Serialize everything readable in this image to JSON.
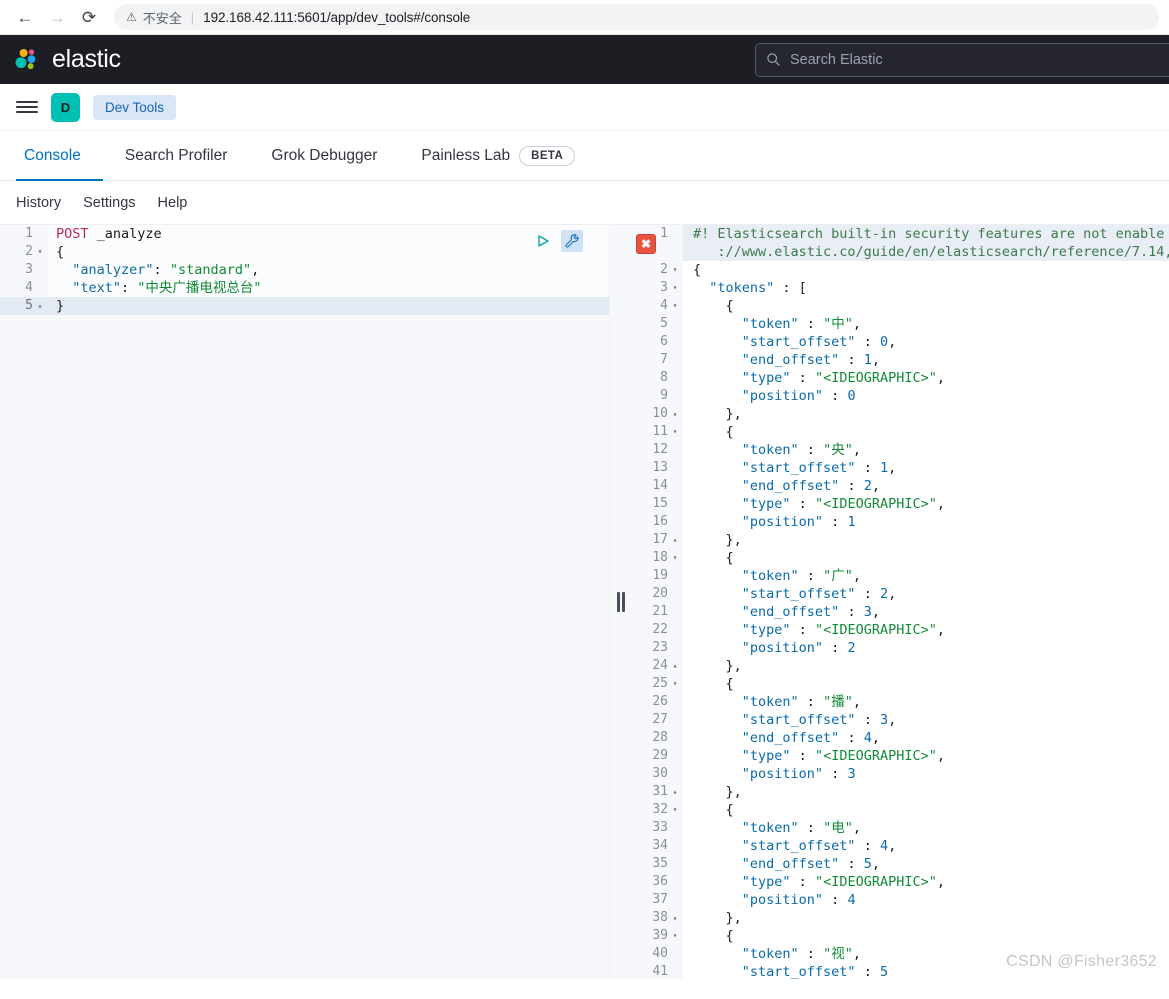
{
  "browser": {
    "back_icon": "arrow-left-icon",
    "forward_icon": "arrow-right-icon",
    "reload_icon": "reload-icon",
    "insecure_label": "不安全",
    "divider": "|",
    "url": "192.168.42.111:5601/app/dev_tools#/console"
  },
  "header": {
    "brand": "elastic",
    "search_placeholder": "Search Elastic"
  },
  "breadcrumb": {
    "menu_icon": "hamburger-menu-icon",
    "avatar_letter": "D",
    "space_badge": "Dev Tools"
  },
  "tabs": [
    {
      "label": "Console",
      "active": true
    },
    {
      "label": "Search Profiler",
      "active": false
    },
    {
      "label": "Grok Debugger",
      "active": false
    },
    {
      "label": "Painless Lab",
      "active": false,
      "badge": "BETA"
    }
  ],
  "subnav": [
    "History",
    "Settings",
    "Help"
  ],
  "editor_actions": {
    "play_icon": "play-triangle-icon",
    "wrench_icon": "wrench-icon"
  },
  "splitter": {
    "grip_icon": "drag-handle-icon"
  },
  "request": {
    "lines": [
      {
        "n": 1,
        "fold": "",
        "active": false,
        "tokens": [
          {
            "t": "POST ",
            "c": "t-method"
          },
          {
            "t": "_analyze",
            "c": "t-url"
          }
        ]
      },
      {
        "n": 2,
        "fold": "down",
        "active": false,
        "tokens": [
          {
            "t": "{",
            "c": "t-brace"
          }
        ]
      },
      {
        "n": 3,
        "fold": "",
        "active": false,
        "indent": 1,
        "tokens": [
          {
            "t": "  \"analyzer\"",
            "c": "t-key"
          },
          {
            "t": ": ",
            "c": "t-punct"
          },
          {
            "t": "\"standard\"",
            "c": "t-str"
          },
          {
            "t": ",",
            "c": "t-punct"
          }
        ]
      },
      {
        "n": 4,
        "fold": "",
        "active": false,
        "indent": 1,
        "tokens": [
          {
            "t": "  \"text\"",
            "c": "t-key"
          },
          {
            "t": ": ",
            "c": "t-punct"
          },
          {
            "t": "\"中央广播电视总台\"",
            "c": "t-str"
          }
        ]
      },
      {
        "n": 5,
        "fold": "up",
        "active": true,
        "tokens": [
          {
            "t": "}",
            "c": "t-brace"
          }
        ]
      }
    ]
  },
  "response": {
    "error_marker": "error-x-icon",
    "lines": [
      {
        "n": 1,
        "fold": "",
        "warn": true,
        "tokens": [
          {
            "t": "#! Elasticsearch built-in security features are not enable",
            "c": "t-cmt"
          }
        ]
      },
      {
        "n": "",
        "fold": "",
        "warn": true,
        "tokens": [
          {
            "t": "   ://www.elastic.co/guide/en/elasticsearch/reference/7.14,",
            "c": "t-cmt"
          }
        ]
      },
      {
        "n": 2,
        "fold": "down",
        "tokens": [
          {
            "t": "{",
            "c": "t-brace"
          }
        ]
      },
      {
        "n": 3,
        "fold": "down",
        "indent": 1,
        "tokens": [
          {
            "t": "  \"tokens\"",
            "c": "t-key"
          },
          {
            "t": " : ",
            "c": "t-punct"
          },
          {
            "t": "[",
            "c": "t-brace"
          }
        ]
      },
      {
        "n": 4,
        "fold": "down",
        "indent": 2,
        "tokens": [
          {
            "t": "    {",
            "c": "t-brace"
          }
        ]
      },
      {
        "n": 5,
        "fold": "",
        "indent": 3,
        "tokens": [
          {
            "t": "      \"token\"",
            "c": "t-key"
          },
          {
            "t": " : ",
            "c": "t-punct"
          },
          {
            "t": "\"中\"",
            "c": "t-str"
          },
          {
            "t": ",",
            "c": "t-punct"
          }
        ]
      },
      {
        "n": 6,
        "fold": "",
        "indent": 3,
        "tokens": [
          {
            "t": "      \"start_offset\"",
            "c": "t-key"
          },
          {
            "t": " : ",
            "c": "t-punct"
          },
          {
            "t": "0",
            "c": "t-num"
          },
          {
            "t": ",",
            "c": "t-punct"
          }
        ]
      },
      {
        "n": 7,
        "fold": "",
        "indent": 3,
        "tokens": [
          {
            "t": "      \"end_offset\"",
            "c": "t-key"
          },
          {
            "t": " : ",
            "c": "t-punct"
          },
          {
            "t": "1",
            "c": "t-num"
          },
          {
            "t": ",",
            "c": "t-punct"
          }
        ]
      },
      {
        "n": 8,
        "fold": "",
        "indent": 3,
        "tokens": [
          {
            "t": "      \"type\"",
            "c": "t-key"
          },
          {
            "t": " : ",
            "c": "t-punct"
          },
          {
            "t": "\"<IDEOGRAPHIC>\"",
            "c": "t-str"
          },
          {
            "t": ",",
            "c": "t-punct"
          }
        ]
      },
      {
        "n": 9,
        "fold": "",
        "indent": 3,
        "tokens": [
          {
            "t": "      \"position\"",
            "c": "t-key"
          },
          {
            "t": " : ",
            "c": "t-punct"
          },
          {
            "t": "0",
            "c": "t-num"
          }
        ]
      },
      {
        "n": 10,
        "fold": "up",
        "indent": 2,
        "tokens": [
          {
            "t": "    },",
            "c": "t-brace"
          }
        ]
      },
      {
        "n": 11,
        "fold": "down",
        "indent": 2,
        "tokens": [
          {
            "t": "    {",
            "c": "t-brace"
          }
        ]
      },
      {
        "n": 12,
        "fold": "",
        "indent": 3,
        "tokens": [
          {
            "t": "      \"token\"",
            "c": "t-key"
          },
          {
            "t": " : ",
            "c": "t-punct"
          },
          {
            "t": "\"央\"",
            "c": "t-str"
          },
          {
            "t": ",",
            "c": "t-punct"
          }
        ]
      },
      {
        "n": 13,
        "fold": "",
        "indent": 3,
        "tokens": [
          {
            "t": "      \"start_offset\"",
            "c": "t-key"
          },
          {
            "t": " : ",
            "c": "t-punct"
          },
          {
            "t": "1",
            "c": "t-num"
          },
          {
            "t": ",",
            "c": "t-punct"
          }
        ]
      },
      {
        "n": 14,
        "fold": "",
        "indent": 3,
        "tokens": [
          {
            "t": "      \"end_offset\"",
            "c": "t-key"
          },
          {
            "t": " : ",
            "c": "t-punct"
          },
          {
            "t": "2",
            "c": "t-num"
          },
          {
            "t": ",",
            "c": "t-punct"
          }
        ]
      },
      {
        "n": 15,
        "fold": "",
        "indent": 3,
        "tokens": [
          {
            "t": "      \"type\"",
            "c": "t-key"
          },
          {
            "t": " : ",
            "c": "t-punct"
          },
          {
            "t": "\"<IDEOGRAPHIC>\"",
            "c": "t-str"
          },
          {
            "t": ",",
            "c": "t-punct"
          }
        ]
      },
      {
        "n": 16,
        "fold": "",
        "indent": 3,
        "tokens": [
          {
            "t": "      \"position\"",
            "c": "t-key"
          },
          {
            "t": " : ",
            "c": "t-punct"
          },
          {
            "t": "1",
            "c": "t-num"
          }
        ]
      },
      {
        "n": 17,
        "fold": "up",
        "indent": 2,
        "tokens": [
          {
            "t": "    },",
            "c": "t-brace"
          }
        ]
      },
      {
        "n": 18,
        "fold": "down",
        "indent": 2,
        "tokens": [
          {
            "t": "    {",
            "c": "t-brace"
          }
        ]
      },
      {
        "n": 19,
        "fold": "",
        "indent": 3,
        "tokens": [
          {
            "t": "      \"token\"",
            "c": "t-key"
          },
          {
            "t": " : ",
            "c": "t-punct"
          },
          {
            "t": "\"广\"",
            "c": "t-str"
          },
          {
            "t": ",",
            "c": "t-punct"
          }
        ]
      },
      {
        "n": 20,
        "fold": "",
        "indent": 3,
        "tokens": [
          {
            "t": "      \"start_offset\"",
            "c": "t-key"
          },
          {
            "t": " : ",
            "c": "t-punct"
          },
          {
            "t": "2",
            "c": "t-num"
          },
          {
            "t": ",",
            "c": "t-punct"
          }
        ]
      },
      {
        "n": 21,
        "fold": "",
        "indent": 3,
        "tokens": [
          {
            "t": "      \"end_offset\"",
            "c": "t-key"
          },
          {
            "t": " : ",
            "c": "t-punct"
          },
          {
            "t": "3",
            "c": "t-num"
          },
          {
            "t": ",",
            "c": "t-punct"
          }
        ]
      },
      {
        "n": 22,
        "fold": "",
        "indent": 3,
        "tokens": [
          {
            "t": "      \"type\"",
            "c": "t-key"
          },
          {
            "t": " : ",
            "c": "t-punct"
          },
          {
            "t": "\"<IDEOGRAPHIC>\"",
            "c": "t-str"
          },
          {
            "t": ",",
            "c": "t-punct"
          }
        ]
      },
      {
        "n": 23,
        "fold": "",
        "indent": 3,
        "tokens": [
          {
            "t": "      \"position\"",
            "c": "t-key"
          },
          {
            "t": " : ",
            "c": "t-punct"
          },
          {
            "t": "2",
            "c": "t-num"
          }
        ]
      },
      {
        "n": 24,
        "fold": "up",
        "indent": 2,
        "tokens": [
          {
            "t": "    },",
            "c": "t-brace"
          }
        ]
      },
      {
        "n": 25,
        "fold": "down",
        "indent": 2,
        "tokens": [
          {
            "t": "    {",
            "c": "t-brace"
          }
        ]
      },
      {
        "n": 26,
        "fold": "",
        "indent": 3,
        "tokens": [
          {
            "t": "      \"token\"",
            "c": "t-key"
          },
          {
            "t": " : ",
            "c": "t-punct"
          },
          {
            "t": "\"播\"",
            "c": "t-str"
          },
          {
            "t": ",",
            "c": "t-punct"
          }
        ]
      },
      {
        "n": 27,
        "fold": "",
        "indent": 3,
        "tokens": [
          {
            "t": "      \"start_offset\"",
            "c": "t-key"
          },
          {
            "t": " : ",
            "c": "t-punct"
          },
          {
            "t": "3",
            "c": "t-num"
          },
          {
            "t": ",",
            "c": "t-punct"
          }
        ]
      },
      {
        "n": 28,
        "fold": "",
        "indent": 3,
        "tokens": [
          {
            "t": "      \"end_offset\"",
            "c": "t-key"
          },
          {
            "t": " : ",
            "c": "t-punct"
          },
          {
            "t": "4",
            "c": "t-num"
          },
          {
            "t": ",",
            "c": "t-punct"
          }
        ]
      },
      {
        "n": 29,
        "fold": "",
        "indent": 3,
        "tokens": [
          {
            "t": "      \"type\"",
            "c": "t-key"
          },
          {
            "t": " : ",
            "c": "t-punct"
          },
          {
            "t": "\"<IDEOGRAPHIC>\"",
            "c": "t-str"
          },
          {
            "t": ",",
            "c": "t-punct"
          }
        ]
      },
      {
        "n": 30,
        "fold": "",
        "indent": 3,
        "tokens": [
          {
            "t": "      \"position\"",
            "c": "t-key"
          },
          {
            "t": " : ",
            "c": "t-punct"
          },
          {
            "t": "3",
            "c": "t-num"
          }
        ]
      },
      {
        "n": 31,
        "fold": "up",
        "indent": 2,
        "tokens": [
          {
            "t": "    },",
            "c": "t-brace"
          }
        ]
      },
      {
        "n": 32,
        "fold": "down",
        "indent": 2,
        "tokens": [
          {
            "t": "    {",
            "c": "t-brace"
          }
        ]
      },
      {
        "n": 33,
        "fold": "",
        "indent": 3,
        "tokens": [
          {
            "t": "      \"token\"",
            "c": "t-key"
          },
          {
            "t": " : ",
            "c": "t-punct"
          },
          {
            "t": "\"电\"",
            "c": "t-str"
          },
          {
            "t": ",",
            "c": "t-punct"
          }
        ]
      },
      {
        "n": 34,
        "fold": "",
        "indent": 3,
        "tokens": [
          {
            "t": "      \"start_offset\"",
            "c": "t-key"
          },
          {
            "t": " : ",
            "c": "t-punct"
          },
          {
            "t": "4",
            "c": "t-num"
          },
          {
            "t": ",",
            "c": "t-punct"
          }
        ]
      },
      {
        "n": 35,
        "fold": "",
        "indent": 3,
        "tokens": [
          {
            "t": "      \"end_offset\"",
            "c": "t-key"
          },
          {
            "t": " : ",
            "c": "t-punct"
          },
          {
            "t": "5",
            "c": "t-num"
          },
          {
            "t": ",",
            "c": "t-punct"
          }
        ]
      },
      {
        "n": 36,
        "fold": "",
        "indent": 3,
        "tokens": [
          {
            "t": "      \"type\"",
            "c": "t-key"
          },
          {
            "t": " : ",
            "c": "t-punct"
          },
          {
            "t": "\"<IDEOGRAPHIC>\"",
            "c": "t-str"
          },
          {
            "t": ",",
            "c": "t-punct"
          }
        ]
      },
      {
        "n": 37,
        "fold": "",
        "indent": 3,
        "tokens": [
          {
            "t": "      \"position\"",
            "c": "t-key"
          },
          {
            "t": " : ",
            "c": "t-punct"
          },
          {
            "t": "4",
            "c": "t-num"
          }
        ]
      },
      {
        "n": 38,
        "fold": "up",
        "indent": 2,
        "tokens": [
          {
            "t": "    },",
            "c": "t-brace"
          }
        ]
      },
      {
        "n": 39,
        "fold": "down",
        "indent": 2,
        "tokens": [
          {
            "t": "    {",
            "c": "t-brace"
          }
        ]
      },
      {
        "n": 40,
        "fold": "",
        "indent": 3,
        "tokens": [
          {
            "t": "      \"token\"",
            "c": "t-key"
          },
          {
            "t": " : ",
            "c": "t-punct"
          },
          {
            "t": "\"视\"",
            "c": "t-str"
          },
          {
            "t": ",",
            "c": "t-punct"
          }
        ]
      },
      {
        "n": 41,
        "fold": "",
        "indent": 3,
        "tokens": [
          {
            "t": "      \"start_offset\"",
            "c": "t-key"
          },
          {
            "t": " : ",
            "c": "t-punct"
          },
          {
            "t": "5",
            "c": "t-num"
          }
        ]
      }
    ]
  },
  "watermark": "CSDN @Fisher3652"
}
